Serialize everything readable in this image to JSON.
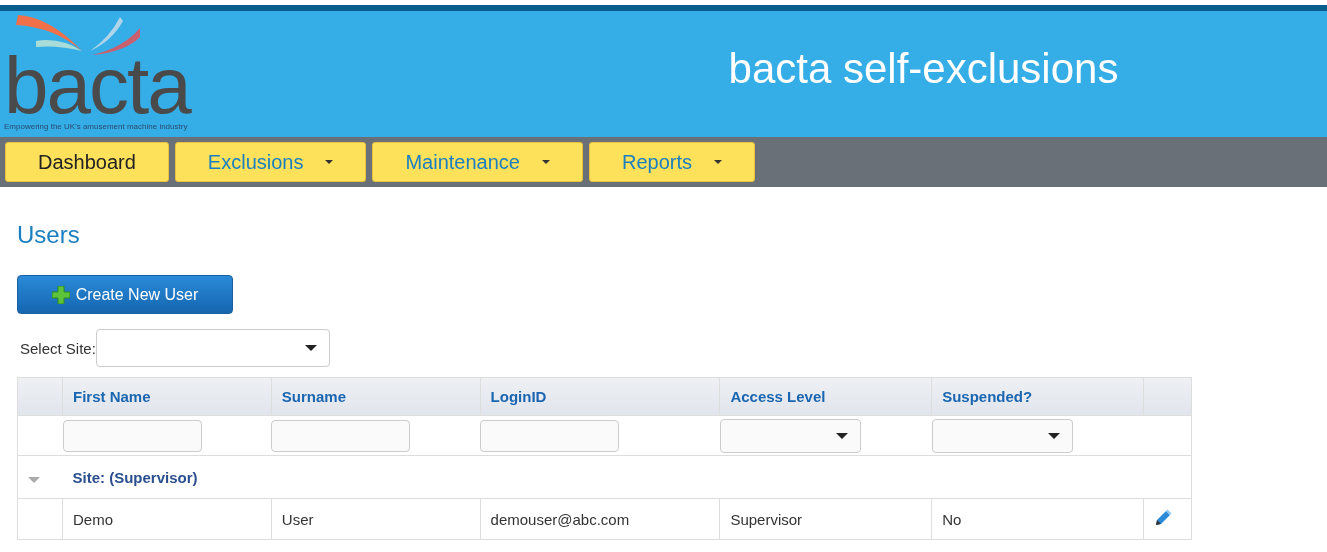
{
  "header": {
    "logo_text": "bacta",
    "tagline": "Empowering the UK's amusement machine industry",
    "title": "bacta self-exclusions"
  },
  "nav": [
    {
      "label": "Dashboard",
      "has_menu": false
    },
    {
      "label": "Exclusions",
      "has_menu": true
    },
    {
      "label": "Maintenance",
      "has_menu": true
    },
    {
      "label": "Reports",
      "has_menu": true
    }
  ],
  "page_title": "Users",
  "create_button": "Create New User",
  "site_select": {
    "label": "Select Site:"
  },
  "table": {
    "columns": [
      "First Name",
      "Surname",
      "LoginID",
      "Access Level",
      "Suspended?"
    ],
    "filters": [
      {
        "kind": "text"
      },
      {
        "kind": "text"
      },
      {
        "kind": "text"
      },
      {
        "kind": "select"
      },
      {
        "kind": "select"
      }
    ],
    "groups": [
      {
        "label": "Site: (Supervisor)",
        "expanded": true,
        "rows": [
          [
            "Demo",
            "User",
            "demouser@abc.com",
            "Supervisor",
            "No"
          ]
        ]
      }
    ]
  }
}
